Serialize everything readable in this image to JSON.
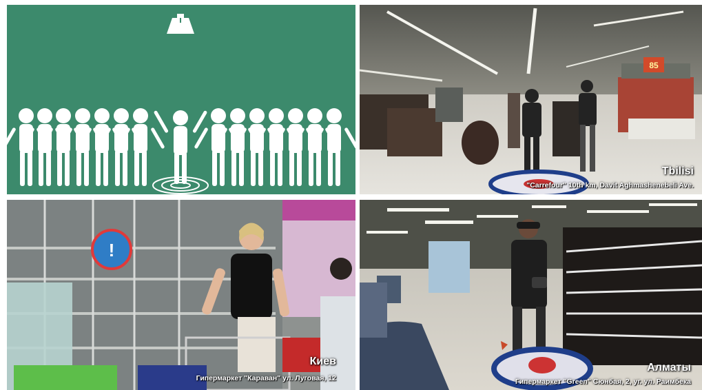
{
  "collage": {
    "panels": [
      {
        "id": "illustration",
        "icon": "crowd-illustration"
      },
      {
        "id": "tbilisi",
        "city": "Tbilisi",
        "address": "\"Carrefour\" 10th km, Davit Aghmashenebeli Ave.",
        "sign": "85"
      },
      {
        "id": "kiev",
        "city": "Киев",
        "address": "Гипермаркет \"Караван\" ул. Луговая, 12"
      },
      {
        "id": "almaty",
        "city": "Алматы",
        "address": "Гипермаркет \"Green\" Сюнбая, 2, уг. ул. Раимбека"
      }
    ],
    "colors": {
      "illustration_bg": "#3c8a6c",
      "figure": "#ffffff"
    }
  }
}
